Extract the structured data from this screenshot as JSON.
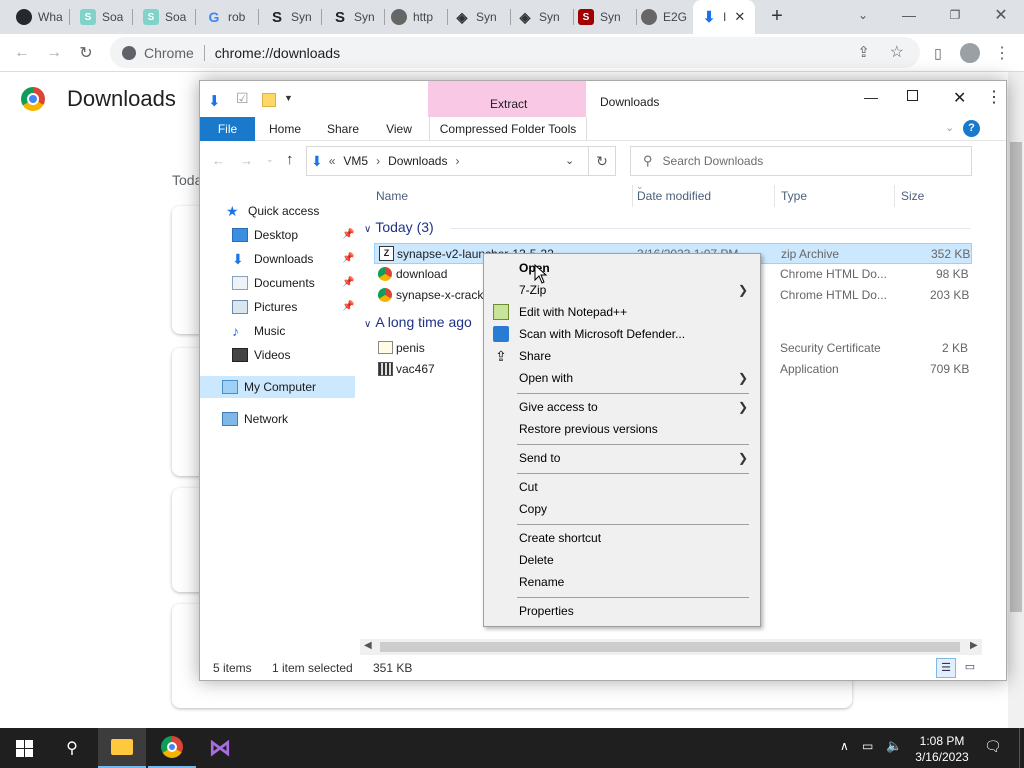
{
  "browser": {
    "tabs": [
      {
        "label": "Wha",
        "icon": "github-icon",
        "color": "#24292f"
      },
      {
        "label": "Soa",
        "icon": "s-icon",
        "color": "#7fd3c8"
      },
      {
        "label": "Soa",
        "icon": "s-icon",
        "color": "#7fd3c8"
      },
      {
        "label": "rob",
        "icon": "google-icon",
        "color": "#4285f4"
      },
      {
        "label": "Syn",
        "icon": "synapse-icon",
        "color": "#222"
      },
      {
        "label": "Syn",
        "icon": "synapse-icon",
        "color": "#222"
      },
      {
        "label": "http",
        "icon": "globe-icon",
        "color": "#555"
      },
      {
        "label": "Syn",
        "icon": "synapse-icon",
        "color": "#333"
      },
      {
        "label": "Syn",
        "icon": "synapse-icon",
        "color": "#333"
      },
      {
        "label": "Syn",
        "icon": "synapse-red-icon",
        "color": "#a00000"
      },
      {
        "label": "E2G",
        "icon": "globe-icon",
        "color": "#555"
      },
      {
        "label": "I",
        "icon": "download-icon",
        "color": "#1a73e8"
      }
    ],
    "omnibox": {
      "site_label": "Chrome",
      "url": "chrome://downloads"
    }
  },
  "downloads_page": {
    "title": "Downloads",
    "today_label": "Toda"
  },
  "explorer": {
    "title": "Downloads",
    "extract_tab": "Extract",
    "ribbon_tabs": [
      "File",
      "Home",
      "Share",
      "View",
      "Compressed Folder Tools"
    ],
    "breadcrumb": [
      "VM5",
      "Downloads"
    ],
    "search_placeholder": "Search Downloads",
    "nav": {
      "quick_access": "Quick access",
      "items": [
        "Desktop",
        "Downloads",
        "Documents",
        "Pictures",
        "Music",
        "Videos"
      ],
      "my_computer": "My Computer",
      "network": "Network"
    },
    "columns": [
      "Name",
      "Date modified",
      "Type",
      "Size"
    ],
    "groups": [
      {
        "label": "Today (3)",
        "files": [
          {
            "name": "synapse-v2-launcher-13-5-22",
            "date": "3/16/2023 1:07 PM",
            "type": "zip Archive",
            "size": "352 KB"
          },
          {
            "name": "download",
            "type": "Chrome HTML Do...",
            "size": "98 KB"
          },
          {
            "name": "synapse-x-crack",
            "type": "Chrome HTML Do...",
            "size": "203 KB"
          }
        ]
      },
      {
        "label": "A long time ago",
        "files": [
          {
            "name": "penis",
            "type": "Security Certificate",
            "size": "2 KB"
          },
          {
            "name": "vac467",
            "type": "Application",
            "size": "709 KB"
          }
        ]
      }
    ],
    "status": {
      "items": "5 items",
      "selected": "1 item selected",
      "size": "351 KB"
    }
  },
  "context_menu": {
    "open": "Open",
    "seven_zip": "7-Zip",
    "notepad": "Edit with Notepad++",
    "defender": "Scan with Microsoft Defender...",
    "share": "Share",
    "open_with": "Open with",
    "give_access": "Give access to",
    "restore": "Restore previous versions",
    "send_to": "Send to",
    "cut": "Cut",
    "copy": "Copy",
    "create_shortcut": "Create shortcut",
    "delete": "Delete",
    "rename": "Rename",
    "properties": "Properties"
  },
  "taskbar": {
    "time": "1:08 PM",
    "date": "3/16/2023"
  },
  "colors": {
    "selection": "#cce8ff",
    "extract_tab": "#f8c8e4",
    "file_tab": "#1979ca",
    "chrome_accent": "#1a73e8"
  }
}
